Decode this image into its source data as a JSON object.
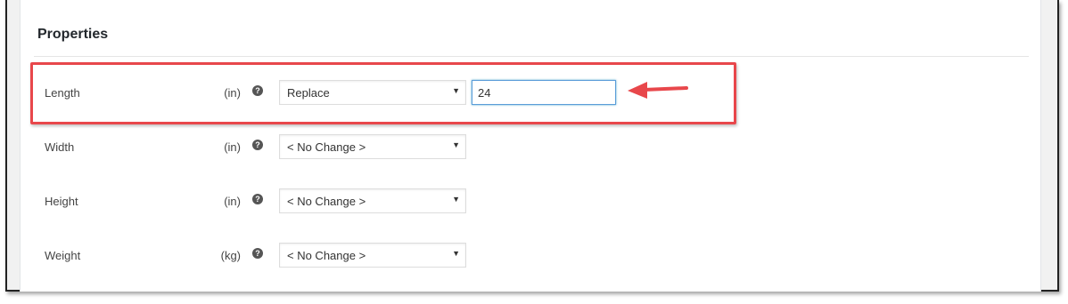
{
  "section": {
    "title": "Properties"
  },
  "rows": [
    {
      "label": "Length",
      "unit": "(in)",
      "help_icon": "?",
      "select_value": "Replace",
      "input_value": "24"
    },
    {
      "label": "Width",
      "unit": "(in)",
      "help_icon": "?",
      "select_value": "< No Change >"
    },
    {
      "label": "Height",
      "unit": "(in)",
      "help_icon": "?",
      "select_value": "< No Change >"
    },
    {
      "label": "Weight",
      "unit": "(kg)",
      "help_icon": "?",
      "select_value": "< No Change >"
    }
  ],
  "icons": {
    "help": "question-circle-icon",
    "caret": "caret-down-icon",
    "arrow": "arrow-left-icon"
  },
  "colors": {
    "highlight": "#e8474b",
    "input_focus": "#5b9dd9"
  }
}
